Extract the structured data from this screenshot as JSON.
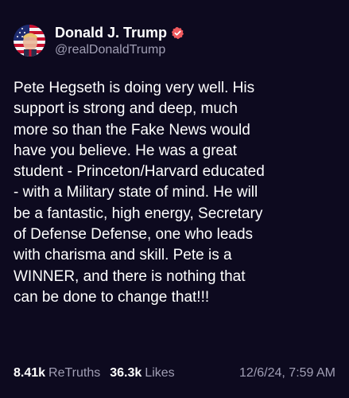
{
  "post": {
    "author": {
      "display_name": "Donald J. Trump",
      "handle": "@realDonaldTrump",
      "verified_icon": "verified-badge-icon",
      "verified_color": "#f15a5e",
      "avatar_icon": "flag-portrait-avatar"
    },
    "text": "Pete Hegseth is doing very well. His\nsupport is strong and deep, much\nmore so than the Fake News would\nhave you believe. He was a great\nstudent - Princeton/Harvard educated\n- with a Military state of mind. He will\nbe a fantastic, high energy, Secretary\nof Defense Defense, one who leads\nwith charisma and skill. Pete is a\nWINNER, and there is nothing that\ncan be done to change that!!!",
    "stats": {
      "retruths_count": "8.41k",
      "retruths_label": "ReTruths",
      "likes_count": "36.3k",
      "likes_label": "Likes"
    },
    "timestamp": "12/6/24, 7:59 AM"
  },
  "colors": {
    "background": "#0d0a1f",
    "text_primary": "#ffffff",
    "text_secondary": "#a19fb5"
  }
}
